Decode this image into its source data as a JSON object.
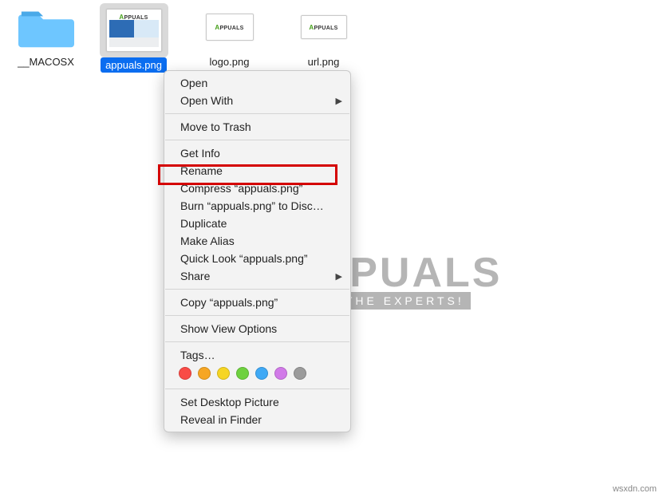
{
  "files": {
    "folder": {
      "name": "__MACOSX"
    },
    "img1": {
      "name": "appuals.png"
    },
    "img2": {
      "name": "logo.png"
    },
    "img3": {
      "name": "url.png"
    }
  },
  "menu": {
    "open": "Open",
    "open_with": "Open With",
    "move_trash": "Move to Trash",
    "get_info": "Get Info",
    "rename": "Rename",
    "compress": "Compress “appuals.png”",
    "burn": "Burn “appuals.png” to Disc…",
    "duplicate": "Duplicate",
    "make_alias": "Make Alias",
    "quick_look": "Quick Look “appuals.png”",
    "share": "Share",
    "copy": "Copy “appuals.png”",
    "view_opts": "Show View Options",
    "tags": "Tags…",
    "set_desktop": "Set Desktop Picture",
    "reveal": "Reveal in Finder"
  },
  "tag_colors": [
    "#f94b46",
    "#f6a623",
    "#f6d523",
    "#6ed13f",
    "#3fa9f5",
    "#d17ae8",
    "#9b9b9b"
  ],
  "watermark": {
    "brand": "PPUALS",
    "tagline": "FROM THE EXPERTS!"
  },
  "credit": "wsxdn.com"
}
